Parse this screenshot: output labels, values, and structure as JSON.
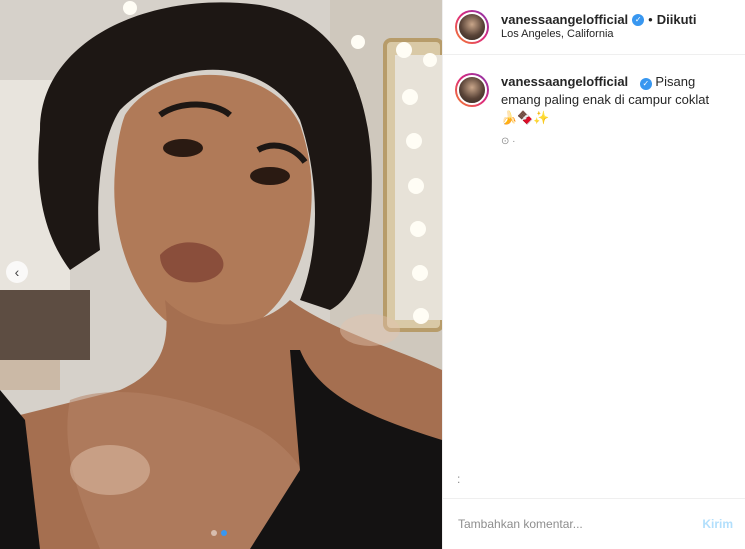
{
  "photo": {
    "prev_icon": "chevron-left-icon",
    "carousel_dots": 2,
    "active_dot": 2
  },
  "header": {
    "username": "vanessaangelofficial",
    "verified_icon": "verified-badge-icon",
    "separator": "•",
    "follow_status": "Diikuti",
    "location": "Los Angeles, California"
  },
  "caption": {
    "username": "vanessaangelofficial",
    "text": "Pisang emang paling enak di campur coklat 🍌🍫✨",
    "meta": "⊙ ·"
  },
  "more_glyph": ":",
  "comment": {
    "placeholder": "Tambahkan komentar...",
    "send_label": "Kirim"
  },
  "colors": {
    "accent": "#3897f0",
    "send_disabled": "#b2dffc",
    "border": "#efefef"
  }
}
